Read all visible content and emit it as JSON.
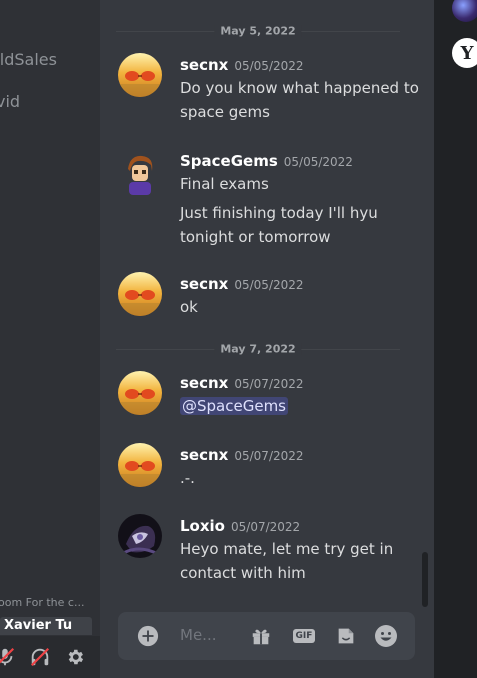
{
  "sidebar": {
    "items": [
      {
        "label": "oldSales"
      },
      {
        "label": "vid"
      }
    ],
    "voice_room_label": "oom For the c...",
    "voice_channel_label": "Xavier Tu",
    "user_controls": [
      {
        "icon": "microphone-muted-icon"
      },
      {
        "icon": "headphones-deafened-icon"
      },
      {
        "icon": "gear-icon"
      }
    ]
  },
  "chat": {
    "dividers": [
      {
        "label": "May 5, 2022"
      },
      {
        "label": "May 7, 2022"
      }
    ],
    "messages": [
      {
        "author": "secnx",
        "timestamp": "05/05/2022",
        "lines": [
          "Do you know what happened to space gems"
        ]
      },
      {
        "author": "SpaceGems",
        "timestamp": "05/05/2022",
        "lines": [
          "Final exams",
          "Just finishing today I'll hyu tonight or tomorrow"
        ]
      },
      {
        "author": "secnx",
        "timestamp": "05/05/2022",
        "lines": [
          "ok"
        ]
      },
      {
        "author": "secnx",
        "timestamp": "05/07/2022",
        "mention": "@SpaceGems"
      },
      {
        "author": "secnx",
        "timestamp": "05/07/2022",
        "lines": [
          ".-."
        ]
      },
      {
        "author": "Loxio",
        "timestamp": "05/07/2022",
        "lines": [
          "Heyo mate, let me try get in contact with him"
        ]
      }
    ],
    "composer": {
      "placeholder": "Me...",
      "icons": [
        "add-attachment-icon",
        "gift-icon",
        "gif-icon",
        "sticker-icon",
        "emoji-icon"
      ],
      "gif_label": "GIF"
    }
  },
  "rail": {
    "server_letter": "Y"
  },
  "colors": {
    "background": "#36393f",
    "sidebar": "#2f3136",
    "rail": "#202225",
    "mention_bg": "#414675",
    "mention_text": "#dee0fc"
  }
}
